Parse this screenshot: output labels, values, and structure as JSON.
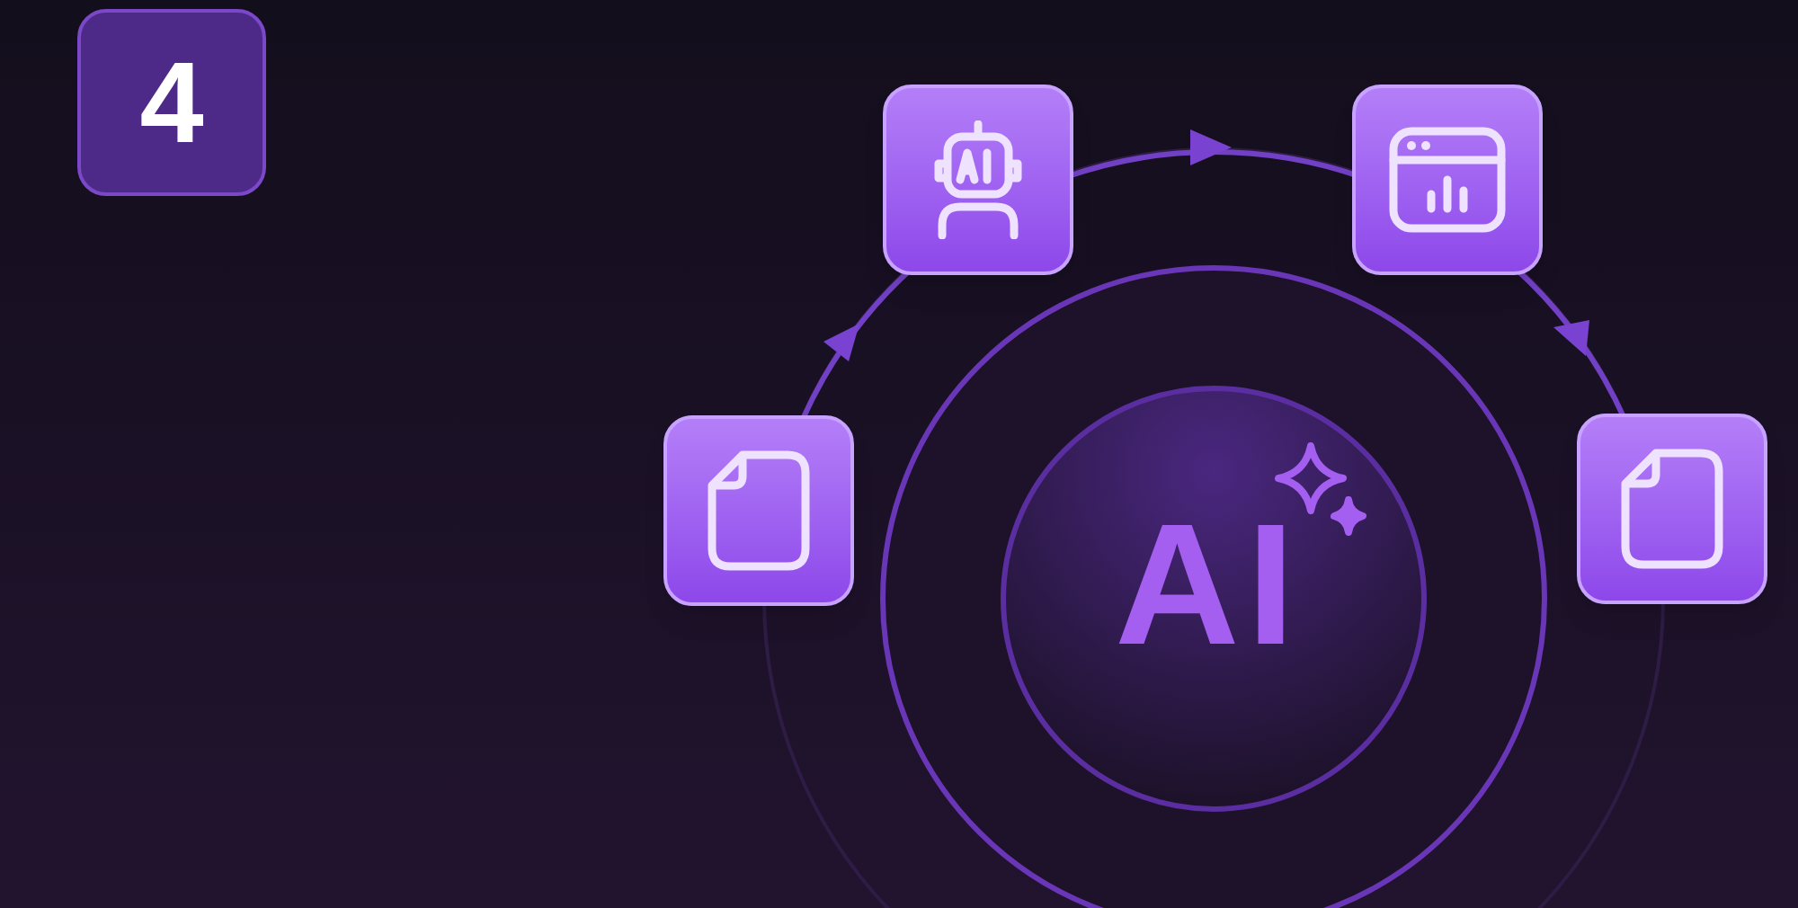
{
  "step_badge": {
    "text": "4"
  },
  "center": {
    "label": "AI"
  },
  "nodes": [
    {
      "kind": "document"
    },
    {
      "kind": "robot"
    },
    {
      "kind": "dashboard"
    },
    {
      "kind": "document"
    }
  ]
}
